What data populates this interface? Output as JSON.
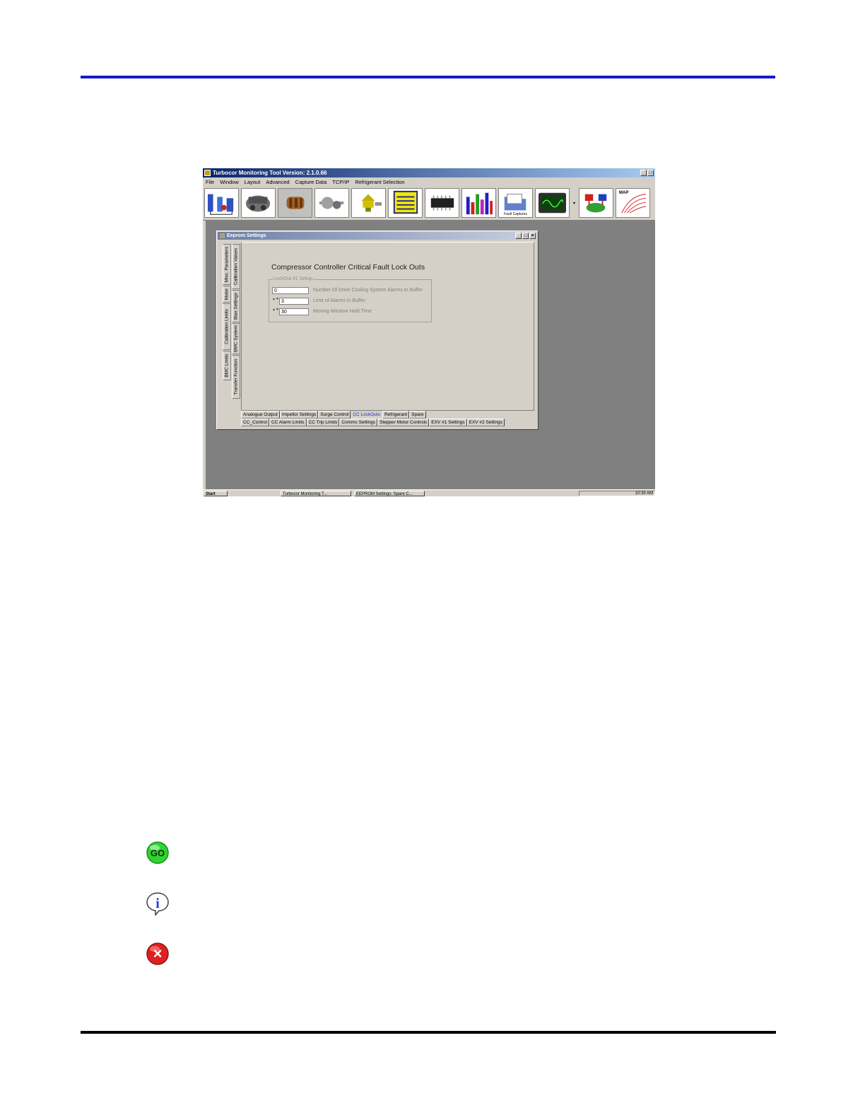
{
  "app": {
    "title": "Turbocor Monitoring Tool Version: 2.1.0.66",
    "window_buttons": [
      "_",
      "□"
    ],
    "menu": [
      "File",
      "Window",
      "Layout",
      "Advanced",
      "Capture Data",
      "TCP/IP",
      "Refrigerant Selection"
    ],
    "toolbar": {
      "fault_captures_label": "Fault Captures",
      "map_label": "MAP",
      "dropdown_glyph": "▾"
    },
    "taskbar": {
      "start": "Start",
      "task1": "Turbocor Monitoring T...",
      "task2": "EEPROM Settings: Spare C...",
      "clock": "10:35 AM"
    }
  },
  "dialog": {
    "title": "Eeprom Settings",
    "buttons": [
      "_",
      "□",
      "×"
    ],
    "vertical_tabs_outer": [
      "Misc. Parameters",
      "Motor",
      "Calibration Limits",
      "BMC Limits"
    ],
    "vertical_tabs_inner": [
      "Calibration Values",
      "Bias Settings",
      "BMC System",
      "Transfer Function"
    ],
    "panel_title": "Compressor Controller Critical Fault Lock Outs",
    "group_title": "LockOut #1 Setup",
    "fields": [
      {
        "value": "0",
        "label": "Number Of Drive Cooling System Alarms In Buffer",
        "spinner": ""
      },
      {
        "value": "3",
        "label": "Limit of Alarms in Buffer",
        "spinner": "▲▼"
      },
      {
        "value": "30",
        "label": "Moving Window Hold Time",
        "spinner": "▲▼"
      }
    ],
    "tabs_row1": [
      "Analogue Output",
      "Impellor Settings",
      "Surge Control",
      "CC LockOuts",
      "Refrigerant",
      "Spare"
    ],
    "active_tab": "CC LockOuts",
    "tabs_row2": [
      "CC_Control",
      "CC Alarm Limits",
      "CC Trip Limits",
      "Comms Settings",
      "Stepper Motor Controls",
      "EXV #1 Settings",
      "EXV #2 Settings"
    ]
  },
  "icons": {
    "go": {
      "label": "GO",
      "color": "#2fd42f"
    },
    "info": {
      "label": "i",
      "color": "#2a3adc"
    },
    "error": {
      "label": "×",
      "color": "#e02020"
    }
  },
  "colors": {
    "top_rule": "#1818c8",
    "bottom_rule": "#000000"
  }
}
